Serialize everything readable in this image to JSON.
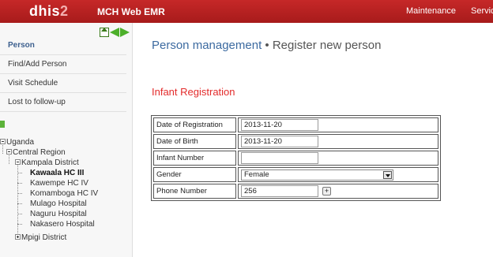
{
  "header": {
    "logo_main": "dhis",
    "logo_num": "2",
    "app_title": "MCH Web EMR",
    "menu": [
      "Maintenance",
      "Service"
    ]
  },
  "sidebar": {
    "items": [
      {
        "label": "Person",
        "active": true
      },
      {
        "label": "Find/Add Person"
      },
      {
        "label": "Visit Schedule"
      },
      {
        "label": "Lost to follow-up"
      }
    ],
    "tree": {
      "root": "Uganda",
      "region": "Central Region",
      "district": "Kampala District",
      "facilities": [
        "Kawaala HC III",
        "Kawempe HC IV",
        "Komamboga HC IV",
        "Mulago Hospital",
        "Naguru Hospital",
        "Nakasero Hospital"
      ],
      "selected": "Kawaala HC III",
      "other_district": "Mpigi District"
    }
  },
  "main": {
    "breadcrumb": "Person management",
    "separator": " • ",
    "page_title": "Register new person",
    "section_title": "Infant Registration",
    "form": {
      "date_of_registration_label": "Date of Registration",
      "date_of_registration_value": "2013-11-20",
      "date_of_birth_label": "Date of Birth",
      "date_of_birth_value": "2013-11-20",
      "infant_number_label": "Infant Number",
      "infant_number_value": "",
      "gender_label": "Gender",
      "gender_value": "Female",
      "phone_label": "Phone Number",
      "phone_value": "256",
      "add_phone_symbol": "+"
    }
  },
  "colors": {
    "header_bg": "#b71c1c",
    "link_blue": "#3c6aa0",
    "section_red": "#e32b2b",
    "icon_green": "#4caf2a"
  }
}
